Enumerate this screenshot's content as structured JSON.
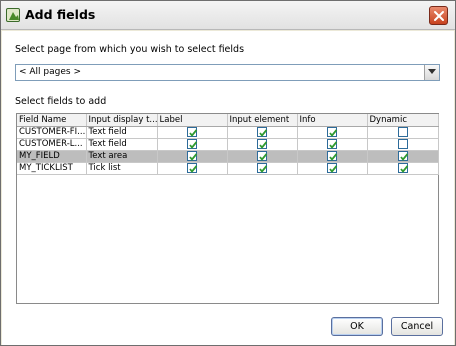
{
  "window": {
    "title": "Add fields"
  },
  "page_select": {
    "label": "Select page from which you wish to select fields",
    "value": "< All pages >"
  },
  "fields": {
    "label": "Select fields to add",
    "columns": [
      "Field Name",
      "Input display t...",
      "Label",
      "Input element",
      "Info",
      "Dynamic"
    ],
    "rows": [
      {
        "name": "CUSTOMER-FI...",
        "display": "Text field",
        "label": true,
        "input": true,
        "info": true,
        "dynamic": false,
        "selected": false
      },
      {
        "name": "CUSTOMER-L...",
        "display": "Text field",
        "label": true,
        "input": true,
        "info": true,
        "dynamic": false,
        "selected": false
      },
      {
        "name": "MY_FIELD",
        "display": "Text area",
        "label": true,
        "input": true,
        "info": true,
        "dynamic": true,
        "selected": true
      },
      {
        "name": "MY_TICKLIST",
        "display": "Tick list",
        "label": true,
        "input": true,
        "info": true,
        "dynamic": true,
        "selected": false
      }
    ]
  },
  "buttons": {
    "ok": "OK",
    "cancel": "Cancel"
  },
  "icons": {
    "app": "app-icon",
    "close": "close-icon",
    "dropdown": "chevron-down-icon",
    "check": "checkmark-icon"
  },
  "colors": {
    "check": "#2f9a2f",
    "selected_row": "#bdbdbd",
    "close_button": "#c8431f"
  }
}
